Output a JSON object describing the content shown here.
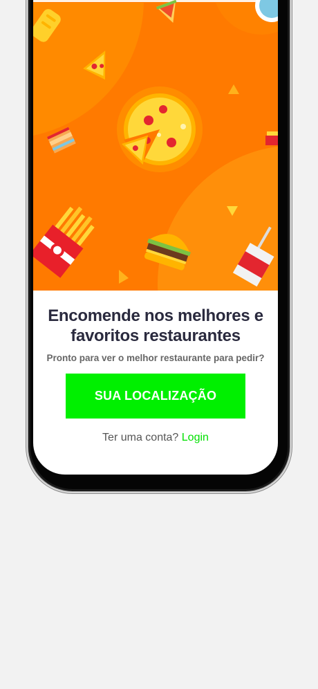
{
  "onboarding": {
    "headline": "Encomende nos melhores e favoritos restaurantes",
    "subtitle": "Pronto para ver o melhor restaurante para pedir?",
    "location_button_label": "SUA LOCALIZAÇÃO",
    "account_prompt": "Ter uma conta?",
    "login_link_label": "Login"
  },
  "hero": {
    "illustration_items": [
      "pizza-icon",
      "pizza-slice-icon",
      "burger-icon",
      "fries-icon",
      "sandwich-icon",
      "drink-icon",
      "cake-icon",
      "bread-icon"
    ],
    "background_color": "#ff7a00"
  },
  "colors": {
    "accent": "#00f000",
    "headline": "#2a2a3e",
    "body_text": "#555555"
  }
}
